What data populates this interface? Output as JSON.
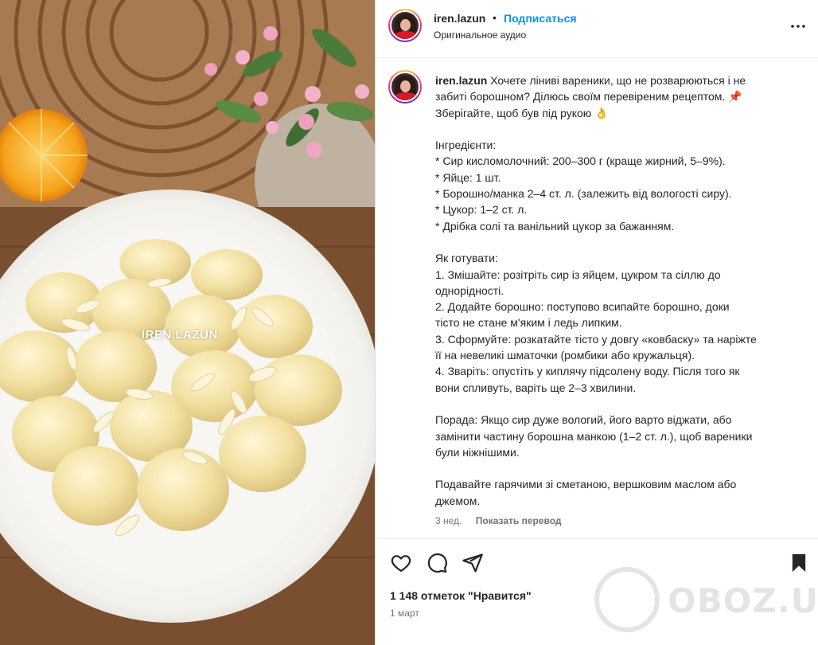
{
  "media": {
    "watermark": "IREN.LAZUN"
  },
  "header": {
    "username": "iren.lazun",
    "separator": "•",
    "follow_label": "Подписаться",
    "audio_label": "Оригинальное аудио"
  },
  "caption": {
    "username": "iren.lazun",
    "text": "Хочете ліниві вареники, що не розварюються і не\nзабиті борошном? Ділюсь своїм перевіреним рецептом. 📌\nЗберігайте, щоб був під рукою 👌\n\nІнгредієнти:\n* Сир кисломолочний: 200–300 г (краще жирний, 5–9%).\n* Яйце: 1 шт.\n* Борошно/манка 2–4 ст. л. (залежить від вологості сиру).\n* Цукор: 1–2 ст. л.\n* Дрібка солі та ванільний цукор за бажанням.\n\nЯк готувати:\n1. Змішайте: розітріть сир із яйцем, цукром та сіллю до\nоднорідності.\n2. Додайте борошно: поступово всипайте борошно, доки\nтісто не стане м'яким і ледь липким.\n3. Сформуйте: розкатайте тісто у довгу «ковбаску» та наріжте\nїї на невеликі шматочки (ромбики або кружальця).\n4. Зваріть: опустіть у киплячу підсолену воду. Після того як\nвони спливуть, варіть ще 2–3 хвилини.\n\nПорада: Якщо сир дуже вологий, його варто віджати, або\nзамінити частину борошна манкою (1–2 ст. л.), щоб вареники\nбули ніжнішими.\n\nПодавайте гарячими зі сметаною, вершковим маслом або\nджемом.",
    "age": "3 нед.",
    "translate_label": "Показать перевод"
  },
  "actions": {
    "likes": "1 148 отметок \"Нравится\"",
    "date": "1 март"
  },
  "watermark_logo": {
    "text": "OBOZ.UA"
  },
  "icons": [
    "more-icon",
    "heart-icon",
    "comment-icon",
    "share-icon",
    "bookmark-icon"
  ]
}
